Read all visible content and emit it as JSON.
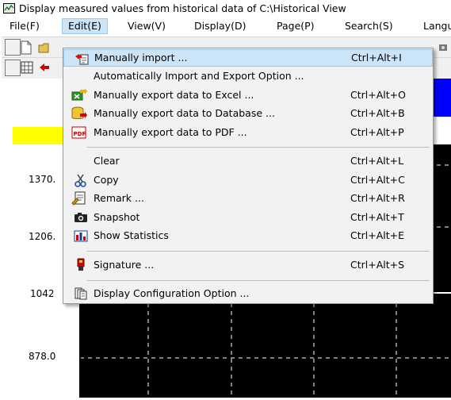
{
  "window": {
    "title": "Display measured values from historical data of C:\\Historical View",
    "icon": "monitor-icon"
  },
  "menubar": {
    "items": [
      {
        "label": "File(F)"
      },
      {
        "label": "Edit(E)",
        "active": true
      },
      {
        "label": "View(V)"
      },
      {
        "label": "Display(D)"
      },
      {
        "label": "Page(P)"
      },
      {
        "label": "Search(S)"
      },
      {
        "label": "Language"
      }
    ]
  },
  "chart": {
    "y_ticks": [
      "1370.",
      "1206.",
      "1042",
      "878.0"
    ],
    "colors": {
      "plot_bg": "#000000",
      "band_blue": "#0000ff",
      "band_yellow": "#ffff00"
    }
  },
  "edit_menu": {
    "items": [
      {
        "label": "Manually import ...",
        "shortcut": "Ctrl+Alt+I",
        "icon": "import-icon",
        "hover": true
      },
      {
        "label": "Automatically Import and Export Option ...",
        "shortcut": "",
        "icon": ""
      },
      {
        "label": "Manually export data to Excel ...",
        "shortcut": "Ctrl+Alt+O",
        "icon": "excel-export-icon"
      },
      {
        "label": "Manually export data to Database ...",
        "shortcut": "Ctrl+Alt+B",
        "icon": "database-export-icon"
      },
      {
        "label": "Manually export data to PDF ...",
        "shortcut": "Ctrl+Alt+P",
        "icon": "pdf-icon"
      },
      {
        "label": "Clear",
        "shortcut": "Ctrl+Alt+L",
        "icon": ""
      },
      {
        "label": "Copy",
        "shortcut": "Ctrl+Alt+C",
        "icon": "scissors-icon"
      },
      {
        "label": "Remark ...",
        "shortcut": "Ctrl+Alt+R",
        "icon": "remark-icon"
      },
      {
        "label": "Snapshot",
        "shortcut": "Ctrl+Alt+T",
        "icon": "camera-icon"
      },
      {
        "label": "Show Statistics",
        "shortcut": "Ctrl+Alt+E",
        "icon": "statistics-icon"
      },
      {
        "label": "Signature ...",
        "shortcut": "Ctrl+Alt+S",
        "icon": "signature-icon"
      },
      {
        "label": "Display Configuration Option ...",
        "shortcut": "",
        "icon": "display-config-icon"
      }
    ]
  }
}
